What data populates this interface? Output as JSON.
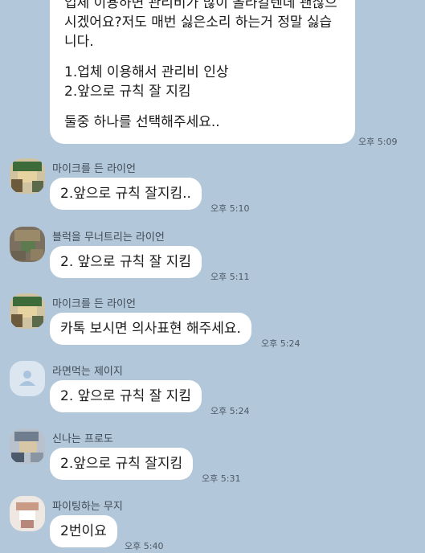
{
  "big_message": {
    "lines": [
      "업체 이용하면 관리비가 많이 올라갈텐데 괜찮으",
      "시겠어요?저도 매번 싫은소리 하는거 정말 싫습",
      "니다.",
      "1.업체 이용해서 관리비 인상",
      "2.앞으로 규칙 잘 지킴",
      "둘중 하나를 선택해주세요.."
    ],
    "time": "오후 5:09"
  },
  "messages": [
    {
      "sender": "마이크를 든 라이언",
      "text": "2.앞으로 규칙 잘지킴..",
      "time": "오후 5:10",
      "avatar_icon": "pixelated-ryan-avatar"
    },
    {
      "sender": "블럭을 무너트리는 라이언",
      "text": "2. 앞으로 규칙 잘 지킴",
      "time": "오후 5:11",
      "avatar_icon": "pixelated-ryan-avatar"
    },
    {
      "sender": "마이크를 든 라이언",
      "text": "카톡 보시면 의사표현 해주세요.",
      "time": "오후 5:24",
      "avatar_icon": "pixelated-ryan-avatar"
    },
    {
      "sender": "라면먹는 제이지",
      "text": "2. 앞으로 규칙 잘 지킴",
      "time": "오후 5:24",
      "avatar_icon": "default-person-avatar"
    },
    {
      "sender": "신나는 프로도",
      "text": "2.앞으로 규칙 잘지킴",
      "time": "오후 5:31",
      "avatar_icon": "pixelated-frodo-avatar"
    },
    {
      "sender": "파이팅하는 무지",
      "text": "2번이요",
      "time": "오후 5:40",
      "avatar_icon": "pixelated-muzi-avatar"
    }
  ],
  "colors": {
    "background": "#b2c7d9",
    "bubble": "#ffffff"
  }
}
